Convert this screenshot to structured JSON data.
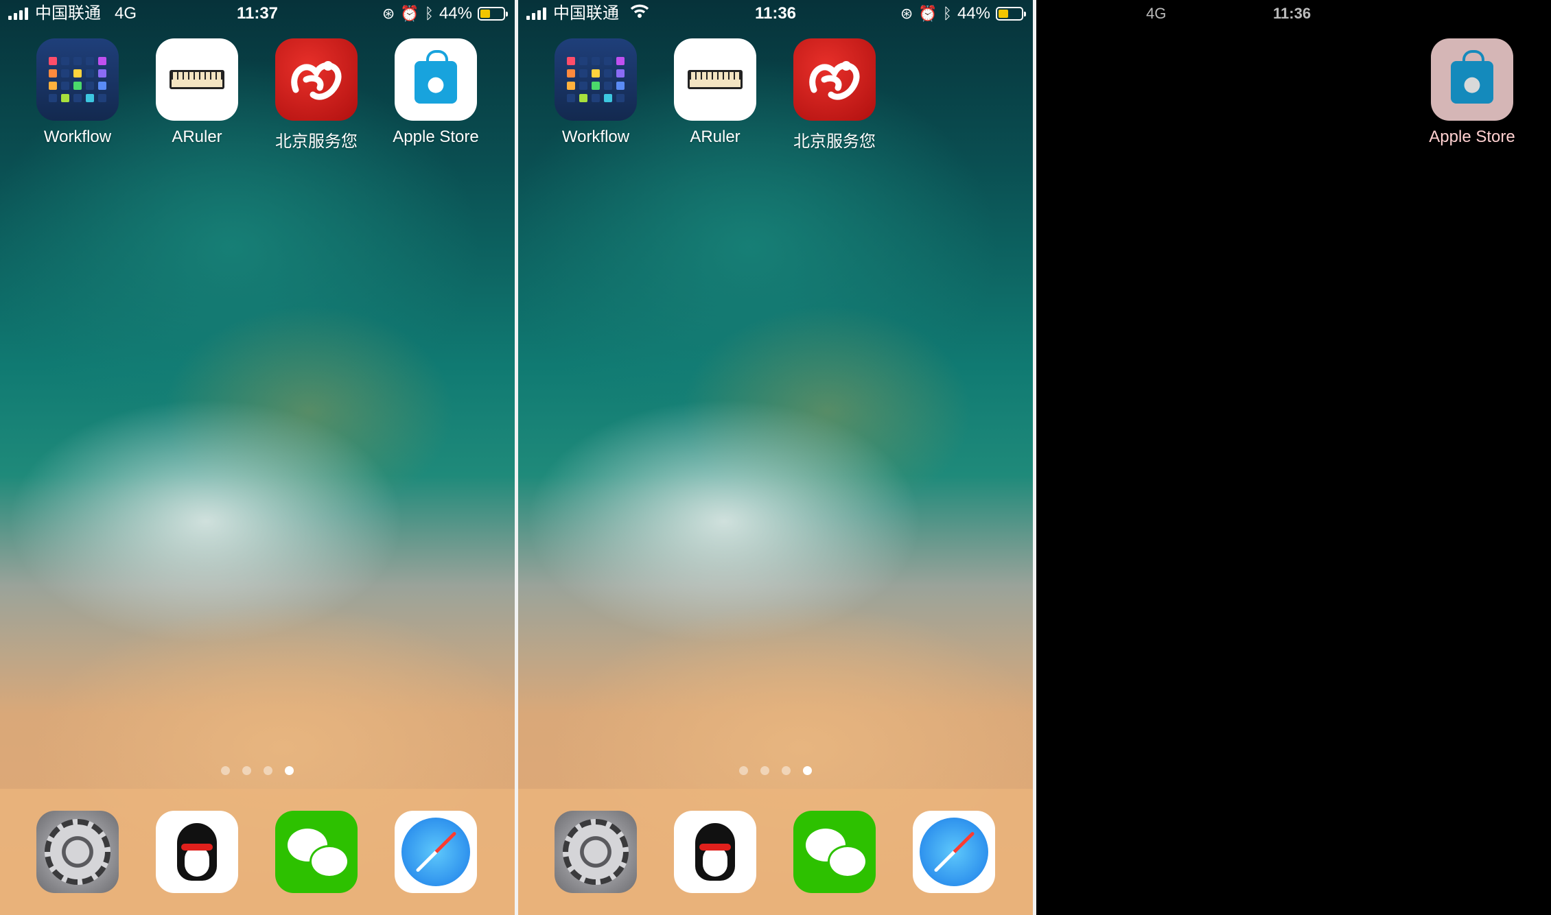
{
  "screens": [
    {
      "status": {
        "carrier": "中国联通",
        "network": "4G",
        "time": "11:37",
        "battery": "44%"
      },
      "apps": [
        "Workflow",
        "ARuler",
        "北京服务您",
        "Apple Store"
      ],
      "page_indicator": {
        "count": 4,
        "current": 4
      }
    },
    {
      "status": {
        "carrier": "中国联通",
        "network": "wifi-icon",
        "time": "11:36",
        "battery": "44%"
      },
      "apps": [
        "Workflow",
        "ARuler",
        "北京服务您"
      ],
      "page_indicator": {
        "count": 4,
        "current": 4
      }
    },
    {
      "status": {
        "network": "4G",
        "time": "11:36"
      },
      "apps": [
        "Apple Store"
      ]
    }
  ],
  "dock": {
    "icons": [
      "settings-icon",
      "qq-icon",
      "wechat-icon",
      "safari-icon"
    ]
  },
  "battery_level": 0.44,
  "colors": {
    "battery": "#f2c500",
    "dock": "#ebb67d",
    "sea": "#107a72",
    "sand": "#e3a974"
  }
}
